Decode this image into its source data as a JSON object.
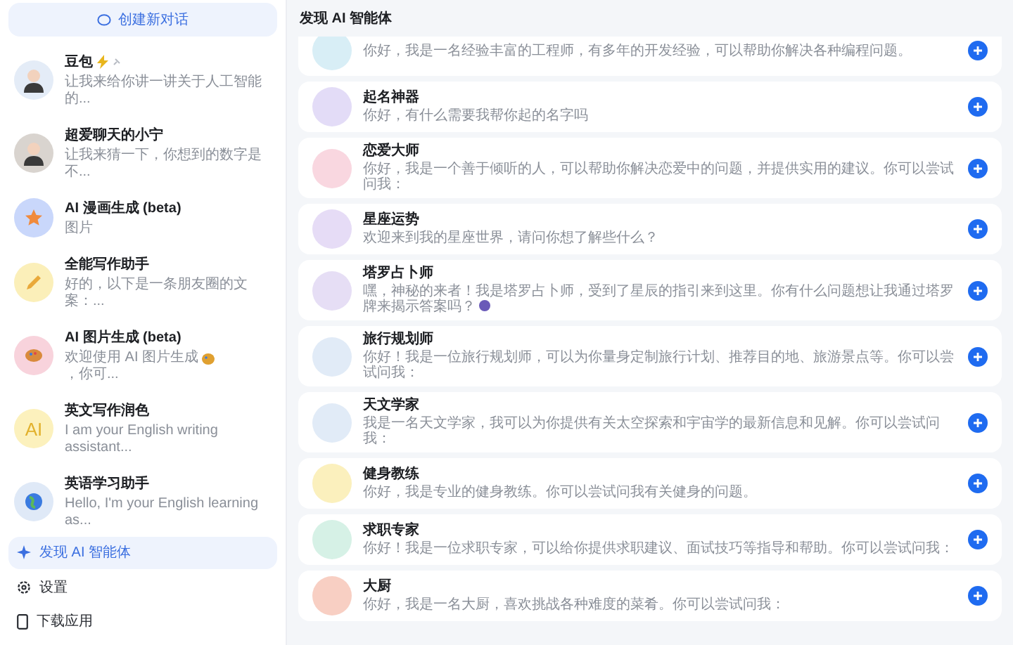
{
  "sidebar": {
    "new_chat": "创建新对话",
    "chats": [
      {
        "title": "豆包",
        "subtitle": "让我来给你讲一讲关于人工智能的...",
        "color": "#e4ecf7",
        "badges": true,
        "kind": "face"
      },
      {
        "title": "超爱聊天的小宁",
        "subtitle": "让我来猜一下，你想到的数字是不...",
        "color": "#d9d4cf",
        "badges": false,
        "kind": "face"
      },
      {
        "title": "AI 漫画生成 (beta)",
        "subtitle": "图片",
        "color": "#c9d7fb",
        "badges": false,
        "kind": "star"
      },
      {
        "title": "全能写作助手",
        "subtitle": "好的，以下是一条朋友圈的文案：...",
        "color": "#fbefb9",
        "badges": false,
        "kind": "pencil"
      },
      {
        "title": "AI 图片生成 (beta)",
        "subtitle": "欢迎使用 AI 图片生成",
        "subtitle_rest": "，你可...",
        "color": "#f8d3dc",
        "badges": false,
        "kind": "palette"
      },
      {
        "title": "英文写作润色",
        "subtitle": "I am your English writing assistant...",
        "color": "#fcf1bd",
        "badges": false,
        "kind": "letters",
        "avatar_text": "AI"
      },
      {
        "title": "英语学习助手",
        "subtitle": "Hello, I'm your English learning as...",
        "color": "#dfe9f7",
        "badges": false,
        "kind": "globe"
      }
    ],
    "nav": [
      {
        "label": "发现 AI 智能体",
        "selected": true
      },
      {
        "label": "设置",
        "selected": false
      },
      {
        "label": "下载应用",
        "selected": false
      }
    ]
  },
  "main": {
    "title": "发现 AI 智能体",
    "agents": [
      {
        "description": "你好，我是一名经验丰富的工程师，有多年的开发经验，可以帮助你解决各种编程问题。",
        "color": "#d8eef6"
      },
      {
        "name": "起名神器",
        "description": "你好，有什么需要我帮你起的名字吗",
        "color": "#e3dcf7"
      },
      {
        "name": "恋爱大师",
        "description": "你好，我是一个善于倾听的人，可以帮助你解决恋爱中的问题，并提供实用的建议。你可以尝试问我：",
        "color": "#f9d7e0"
      },
      {
        "name": "星座运势",
        "description": "欢迎来到我的星座世界，请问你想了解些什么？",
        "color": "#e6dcf6"
      },
      {
        "name": "塔罗占卜师",
        "description": "嘿，神秘的来者！我是塔罗占卜师，受到了星辰的指引来到这里。你有什么问题想让我通过塔罗牌来揭示答案吗？",
        "color": "#e6def5",
        "kind": "trailing-icon"
      },
      {
        "name": "旅行规划师",
        "description": "你好！我是一位旅行规划师，可以为你量身定制旅行计划、推荐目的地、旅游景点等。你可以尝试问我：",
        "color": "#e1ebf7"
      },
      {
        "name": "天文学家",
        "description": "我是一名天文学家，我可以为你提供有关太空探索和宇宙学的最新信息和见解。你可以尝试问我：",
        "color": "#e1ebf7"
      },
      {
        "name": "健身教练",
        "description": "你好，我是专业的健身教练。你可以尝试问我有关健身的问题。",
        "color": "#fbf0bd"
      },
      {
        "name": "求职专家",
        "description": "你好！我是一位求职专家，可以给你提供求职建议、面试技巧等指导和帮助。你可以尝试问我：",
        "color": "#d6f1e6"
      },
      {
        "name": "大厨",
        "description": "你好，我是一名大厨，喜欢挑战各种难度的菜肴。你可以尝试问我：",
        "color": "#f8cfc3"
      }
    ]
  }
}
